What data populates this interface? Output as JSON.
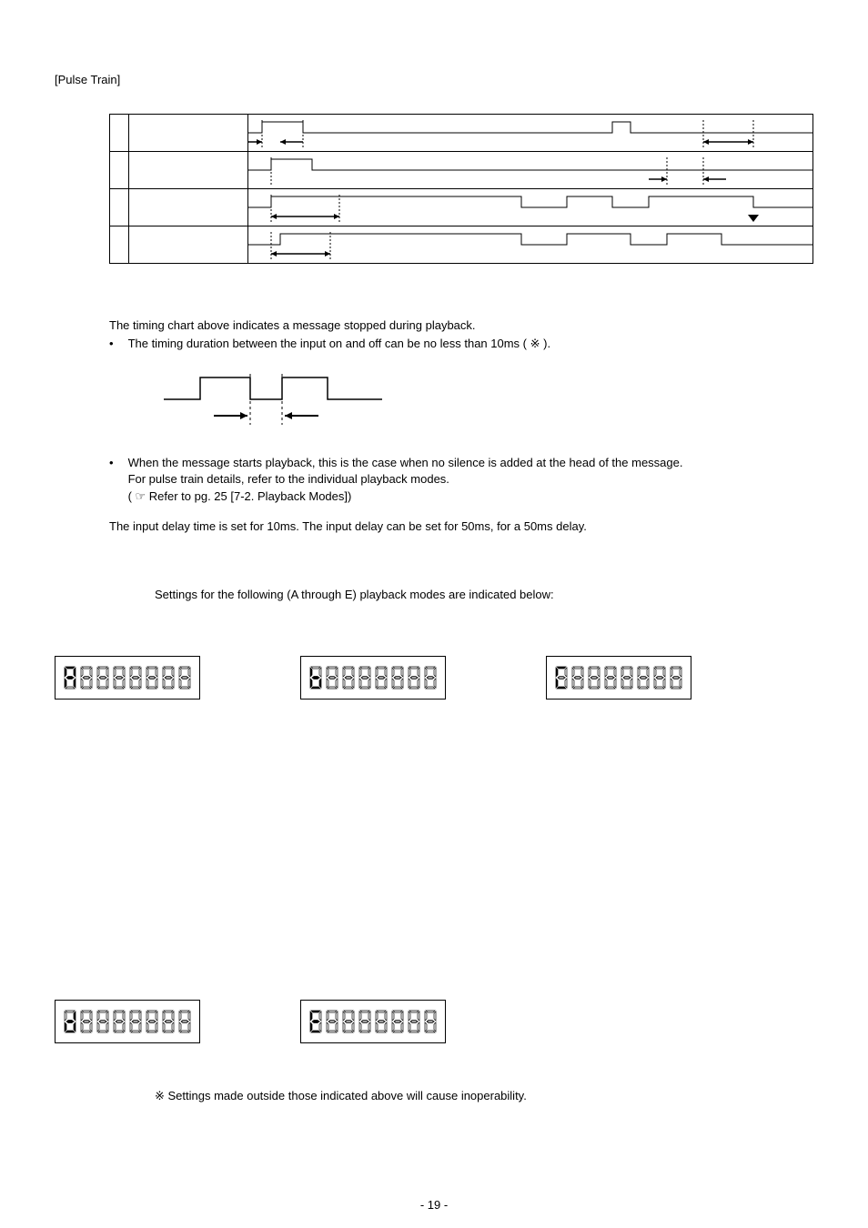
{
  "title": "[Pulse Train]",
  "para1": "The timing chart above indicates a message stopped during playback.",
  "bullet1": "The timing duration between the input on and off can be no less than 10ms ( ※ ).",
  "bullet2a": "When the message starts playback, this is the case when no silence is added at the head of the message.",
  "bullet2b": "For pulse train details, refer to the individual playback modes.",
  "bullet2c": "( ☞ Refer to pg. 25 [7-2. Playback Modes])",
  "para2": "The input delay time is set for 10ms.  The input delay can be set for 50ms, for a 50ms delay.",
  "settings_intro": "Settings for the following (A through E) playback modes are indicated below:",
  "warning": "※ Settings made outside those indicated above will cause inoperability.",
  "page_number": "- 19 -",
  "lcd_values": [
    "A",
    "B",
    "C",
    "D",
    "E"
  ]
}
